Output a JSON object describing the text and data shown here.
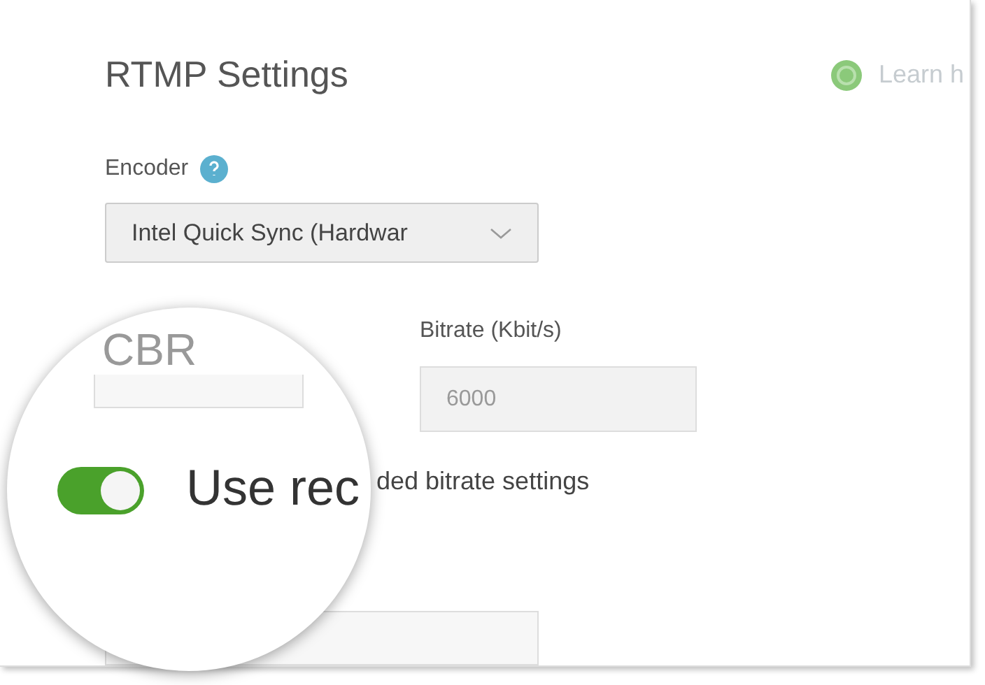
{
  "title": "RTMP Settings",
  "help_link": {
    "label": "Learn h"
  },
  "encoder": {
    "label": "Encoder",
    "value": "Intel Quick Sync (Hardwar"
  },
  "bitrate": {
    "label": "Bitrate (Kbit/s)",
    "placeholder": "6000"
  },
  "toggle_label_visible": "ded bitrate settings",
  "magnifier": {
    "rate_control_value": "CBR",
    "toggle_label": "Use rec",
    "toggle_on": true
  }
}
